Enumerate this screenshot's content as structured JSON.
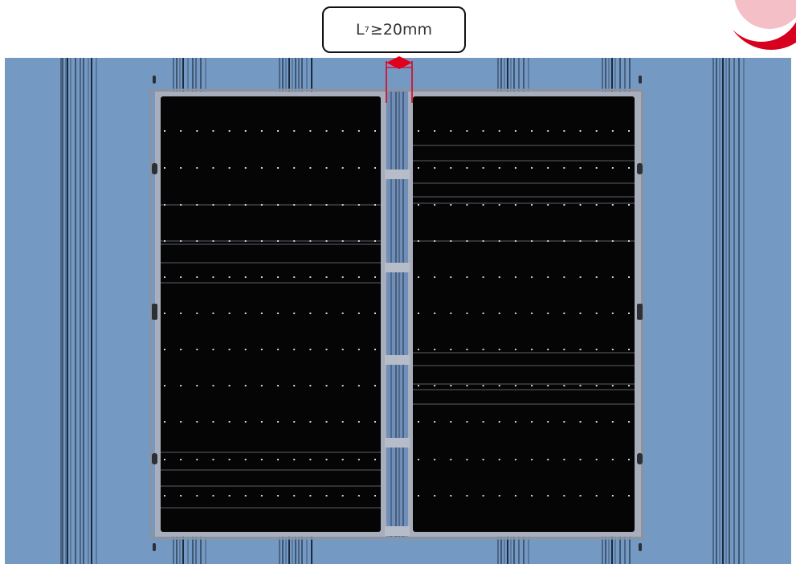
{
  "dimension_label": {
    "symbol": "L",
    "subscript": "7",
    "relation": "≥",
    "value": "20mm"
  },
  "colors": {
    "roof_background": "#7499c3",
    "panel_cells": "#050505",
    "panel_frame": "#9fa6b3",
    "measurement_marker": "#e0001b",
    "logo_red": "#d7001e",
    "callout_border": "#111111"
  },
  "icons": [
    "logo-icon",
    "double-arrow-icon"
  ]
}
